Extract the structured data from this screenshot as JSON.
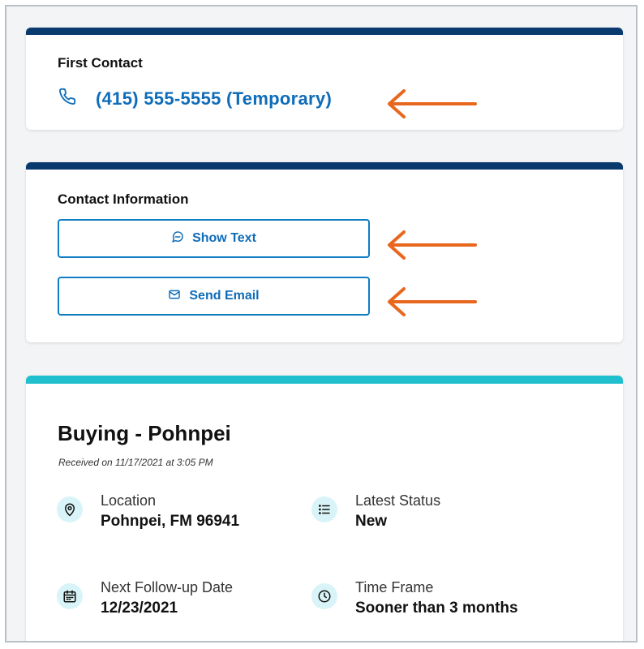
{
  "first_contact": {
    "title": "First Contact",
    "phone": "(415) 555-5555 (Temporary)",
    "phone_icon": "phone-icon"
  },
  "contact_information": {
    "title": "Contact Information",
    "show_text_label": "Show Text",
    "send_email_label": "Send Email",
    "text_icon": "chat-bubble-icon",
    "email_icon": "envelope-icon"
  },
  "lead": {
    "title": "Buying - Pohnpei",
    "received": "Received on 11/17/2021 at 3:05 PM",
    "location_label": "Location",
    "location_value": "Pohnpei, FM 96941",
    "status_label": "Latest Status",
    "status_value": "New",
    "followup_label": "Next Follow-up Date",
    "followup_value": "12/23/2021",
    "timeframe_label": "Time Frame",
    "timeframe_value": "Sooner than 3 months"
  },
  "colors": {
    "header_bar": "#083a6e",
    "lead_bar": "#20bfcd",
    "link_blue": "#0f6cb8",
    "annotation_arrow": "#e8671e",
    "icon_bg": "#d9f4f8"
  }
}
